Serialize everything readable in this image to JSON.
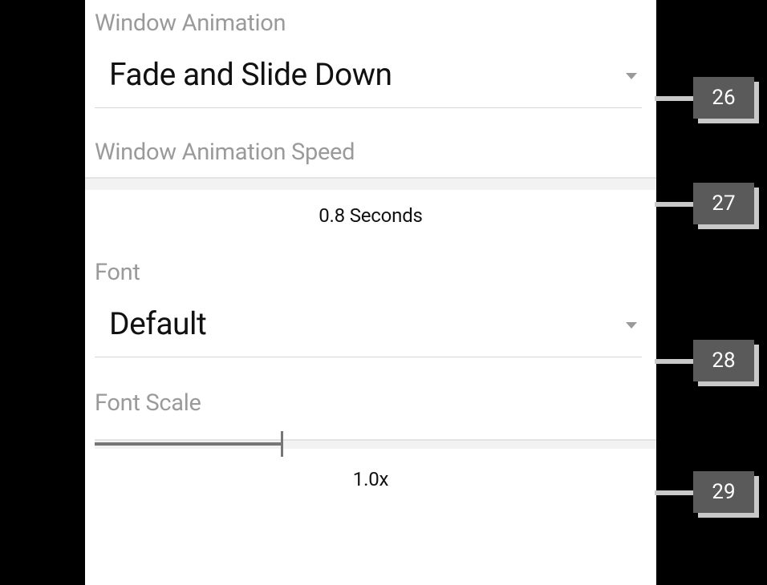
{
  "settings": {
    "window_animation": {
      "label": "Window Animation",
      "value": "Fade and Slide Down"
    },
    "window_animation_speed": {
      "label": "Window Animation Speed",
      "value_text": "0.8 Seconds"
    },
    "font": {
      "label": "Font",
      "value": "Default"
    },
    "font_scale": {
      "label": "Font Scale",
      "value_text": "1.0x"
    }
  },
  "markers": {
    "m26": "26",
    "m27": "27",
    "m28": "28",
    "m29": "29"
  }
}
